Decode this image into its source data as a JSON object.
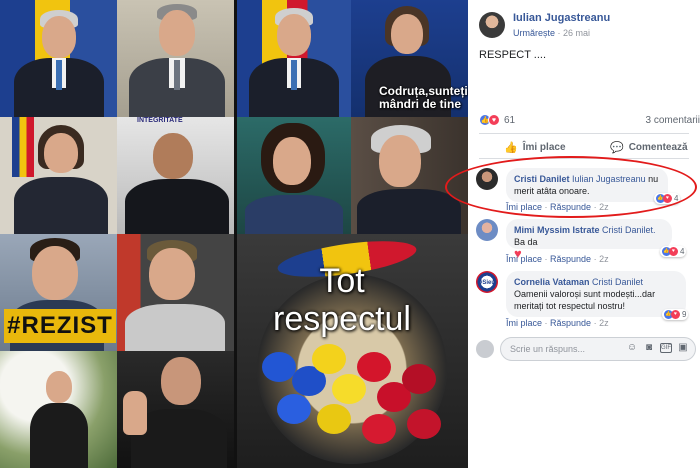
{
  "post": {
    "author": "Iulian Jugastreanu",
    "follow_label": "Urmărește",
    "separator": "·",
    "date": "26 mai",
    "text": "RESPECT ....",
    "reaction_count": "61",
    "comment_count": "3 comentarii",
    "actions": {
      "like": "Îmi place",
      "comment": "Comentează"
    }
  },
  "collage": {
    "caption_1": "Codruța,sunteți mândri de tine",
    "caption_2": "INTEGRITATE",
    "rezist": "#REZIST",
    "tot_respectul": "Tot respectul"
  },
  "comments": [
    {
      "name": "Cristi Danilet",
      "tag": "Iulian Jugastreanu",
      "text": "nu merit atâta onoare.",
      "like": "Îmi place",
      "reply": "Răspunde",
      "time": "2z",
      "reaction_count": "4"
    },
    {
      "name": "Mimi Myssim Istrate",
      "tag": "Cristi Danilet.",
      "text": "Ba da",
      "like": "Îmi place",
      "reply": "Răspunde",
      "time": "2z",
      "reaction_count": "4"
    },
    {
      "name": "Cornelia Vataman",
      "tag": "Cristi Danilet",
      "text": "Oamenii valoroși sunt modești...dar meritați tot respectul nostru!",
      "like": "Îmi place",
      "reply": "Răspunde",
      "time": "2z",
      "reaction_count": "9",
      "avatar_text": "#Sieu"
    }
  ],
  "reply_box": {
    "placeholder": "Scrie un răspuns..."
  },
  "icons": {
    "like": "thumbs-up-icon",
    "comment": "speech-bubble-icon",
    "emoji": "smiley-icon",
    "camera": "camera-icon",
    "gif": "gif-icon",
    "sticker": "sticker-icon"
  },
  "colors": {
    "link_blue": "#385898",
    "like_blue": "#4a76e8",
    "love_red": "#f33e58",
    "highlight_red": "#e21b1b",
    "bubble_gray": "#f2f3f5"
  }
}
